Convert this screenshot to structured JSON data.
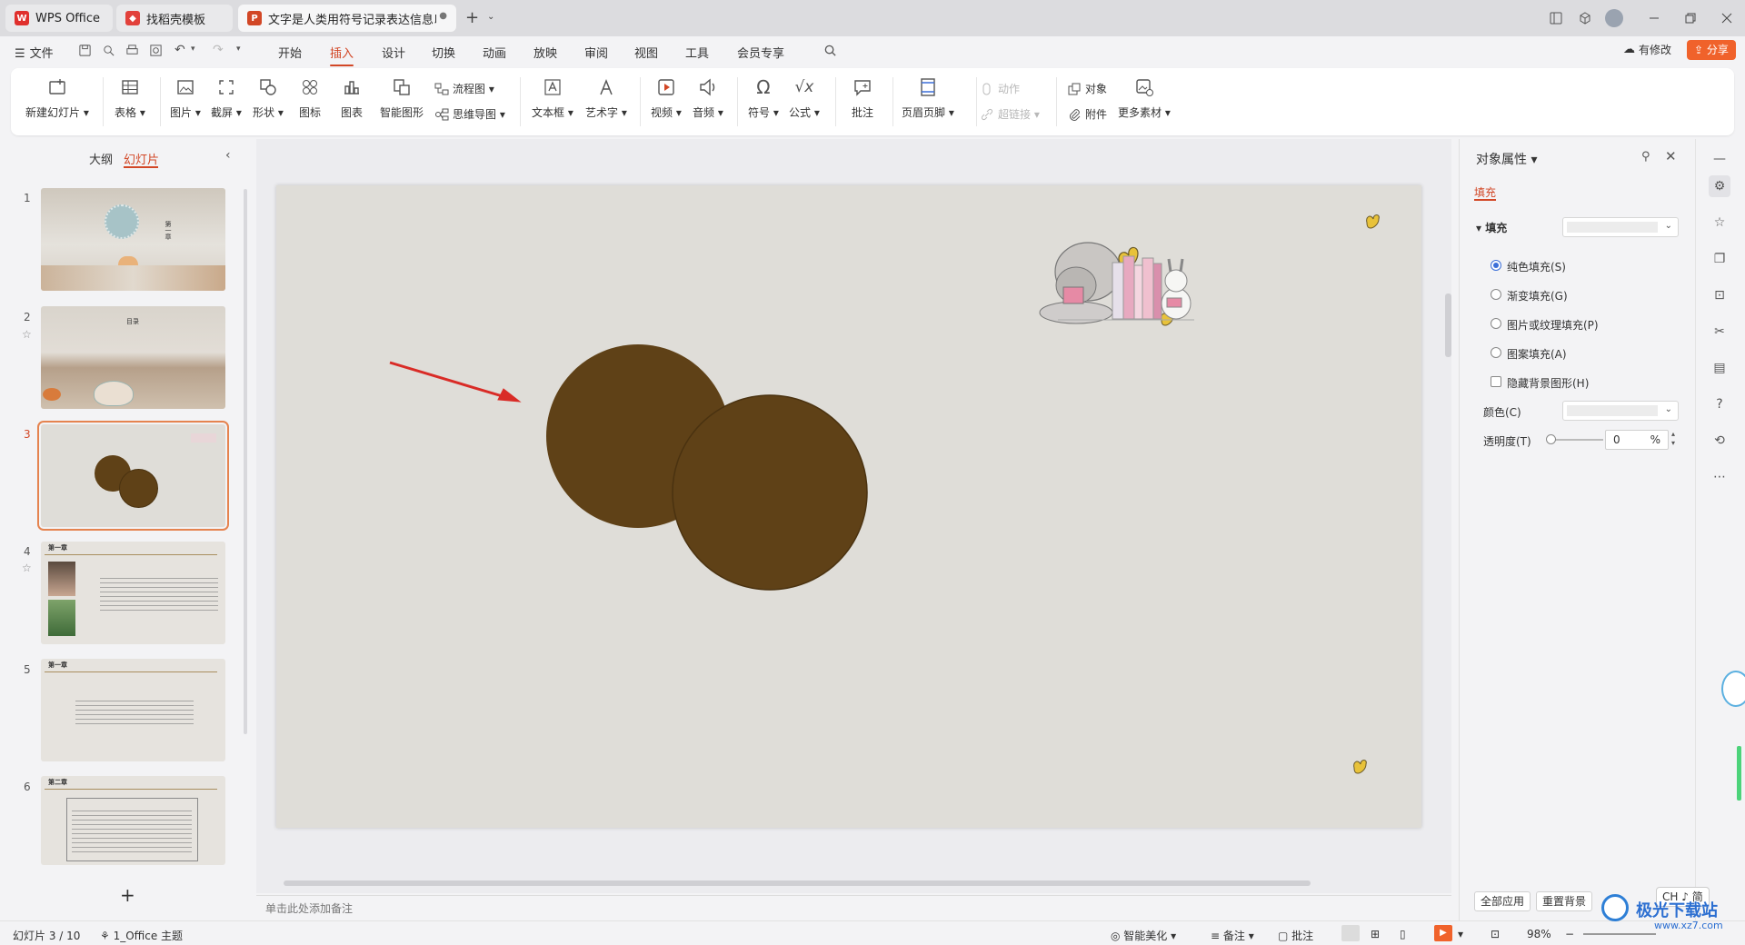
{
  "tabs": [
    {
      "label": "WPS Office",
      "icon": "wps-logo-icon"
    },
    {
      "label": "找稻壳模板",
      "icon": "docer-icon"
    },
    {
      "label": "文字是人类用符号记录表达信息以",
      "icon": "ppt-icon"
    }
  ],
  "menu": {
    "file": "文件",
    "items": [
      "开始",
      "插入",
      "设计",
      "切换",
      "动画",
      "放映",
      "审阅",
      "视图",
      "工具",
      "会员专享"
    ],
    "active": "插入",
    "modified": "有修改",
    "share": "分享"
  },
  "ribbon": {
    "new_slide": "新建幻灯片",
    "table": "表格",
    "picture": "图片",
    "screenshot": "截屏",
    "shape": "形状",
    "icon": "图标",
    "chart": "图表",
    "smart_graphic": "智能图形",
    "flowchart": "流程图",
    "mindmap": "思维导图",
    "textbox": "文本框",
    "art_text": "艺术字",
    "video": "视频",
    "audio": "音频",
    "symbol": "符号",
    "formula": "公式",
    "comment": "批注",
    "header_footer": "页眉页脚",
    "action": "动作",
    "hyperlink": "超链接",
    "object": "对象",
    "attachment": "附件",
    "more_material": "更多素材"
  },
  "left_panel": {
    "outline_tab": "大纲",
    "slides_tab": "幻灯片",
    "slides": [
      {
        "num": "1",
        "starred": false,
        "title": "第一章"
      },
      {
        "num": "2",
        "starred": true,
        "title": "目录"
      },
      {
        "num": "3",
        "starred": false,
        "selected": true
      },
      {
        "num": "4",
        "starred": true,
        "title": "第一章"
      },
      {
        "num": "5",
        "starred": false,
        "title": "第一章"
      },
      {
        "num": "6",
        "starred": false,
        "title": "第二章"
      }
    ],
    "add_slide": "+"
  },
  "notes_placeholder": "单击此处添加备注",
  "properties": {
    "title": "对象属性",
    "tab": "填充",
    "section": "填充",
    "options": [
      "纯色填充(S)",
      "渐变填充(G)",
      "图片或纹理填充(P)",
      "图案填充(A)"
    ],
    "selected_option": 0,
    "hide_bg": "隐藏背景图形(H)",
    "color_label": "颜色(C)",
    "transparency_label": "透明度(T)",
    "transparency_value": "0",
    "percent": "%",
    "apply_all": "全部应用",
    "reset_bg": "重置背景"
  },
  "status": {
    "slide_info": "幻灯片 3 / 10",
    "theme": "1_Office 主题",
    "beautify": "智能美化",
    "notes": "备注",
    "comments": "批注",
    "zoom": "98%",
    "ime": "CH ♪ 简"
  },
  "watermark": "极光下载站",
  "watermark_url": "www.xz7.com",
  "colors": {
    "accent": "#d24726",
    "circle_fill": "#5f4117",
    "circle_stroke": "#4a3210",
    "arrow": "#d92b26",
    "slide_bg": "#dfddd8",
    "share_bg": "#f0622b"
  }
}
